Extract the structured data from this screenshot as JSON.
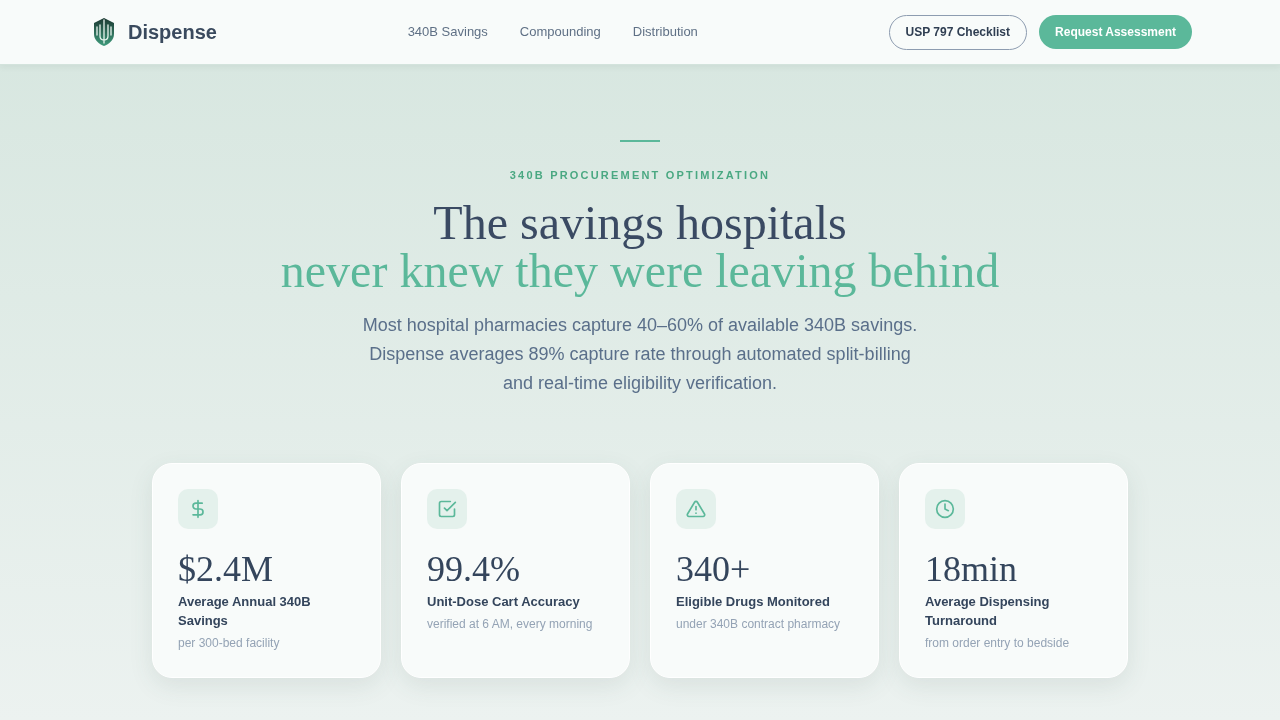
{
  "header": {
    "logo_text": "Dispense",
    "nav": [
      {
        "label": "340B Savings"
      },
      {
        "label": "Compounding"
      },
      {
        "label": "Distribution"
      }
    ],
    "buttons": [
      {
        "label": "USP 797 Checklist",
        "kind": "outline"
      },
      {
        "label": "Request Assessment",
        "kind": "primary"
      }
    ]
  },
  "hero": {
    "eyebrow": "340B PROCUREMENT OPTIMIZATION",
    "headline": [
      {
        "text": "The savings hospitals",
        "accent": false
      },
      {
        "text": "never knew they were leaving behind",
        "accent": true
      }
    ],
    "description": "Most hospital pharmacies capture 40–60% of available 340B savings. Dispense averages 89% capture rate through automated split-billing and real-time eligibility verification."
  },
  "stats": [
    {
      "value": "$2.4M",
      "label": "Average Annual 340B Savings",
      "note": "per 300-bed facility"
    },
    {
      "value": "99.4%",
      "label": "Unit-Dose Cart Accuracy",
      "note": "verified at 6 AM, every morning"
    },
    {
      "value": "340+",
      "label": "Eligible Drugs Monitored",
      "note": "under 340B contract pharmacy"
    },
    {
      "value": "18min",
      "label": "Average Dispensing Turnaround",
      "note": "from order entry to bedside"
    }
  ]
}
